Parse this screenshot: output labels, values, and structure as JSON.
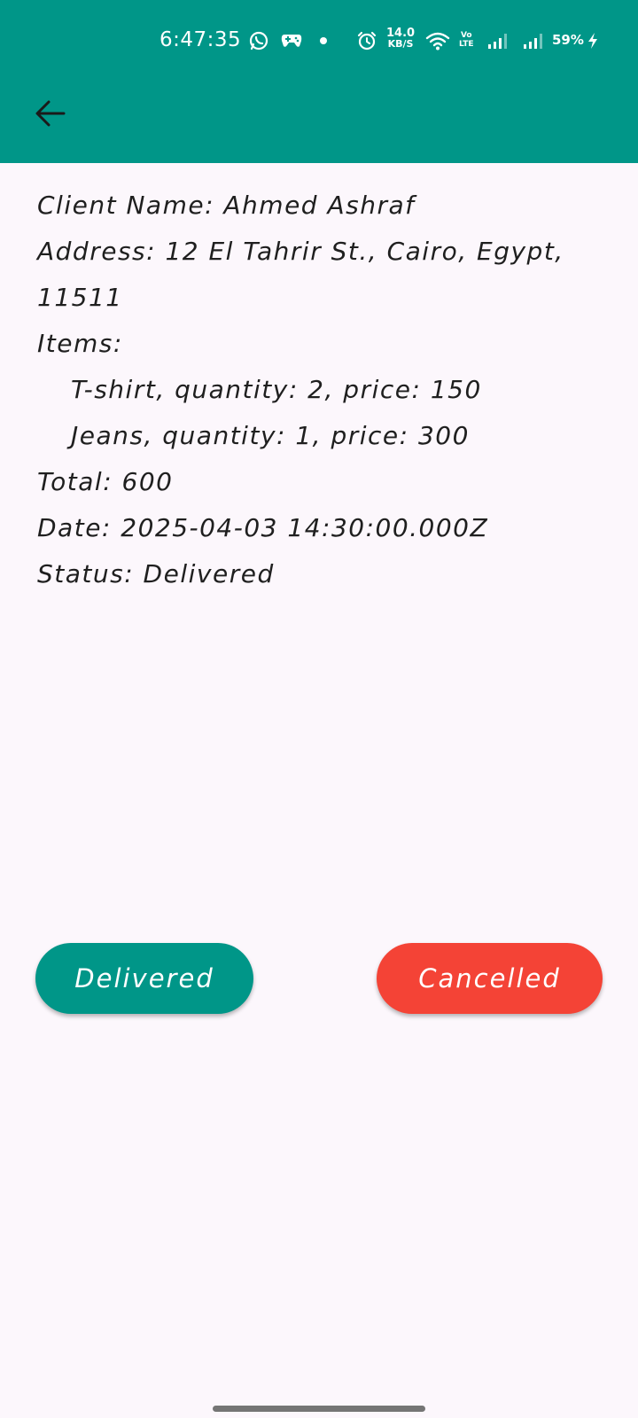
{
  "status_bar": {
    "time": "6:47:35",
    "net_speed_value": "14.0",
    "net_speed_unit": "KB/S",
    "volte_top": "Vo",
    "volte_bottom": "LTE",
    "battery": "59%",
    "icons": [
      "whatsapp-icon",
      "gamepad-icon",
      "dot-icon",
      "alarm-icon",
      "wifi-icon",
      "signal-icon",
      "signal-icon",
      "charging-icon"
    ]
  },
  "app_bar": {
    "back_icon": "arrow-left-icon",
    "color": "#009688"
  },
  "order": {
    "client_line": "Client Name: Ahmed Ashraf",
    "address_line_1": "Address: 12 El Tahrir St., Cairo, Egypt,",
    "address_line_2": "11511",
    "items_label": "Items:",
    "items": [
      "T-shirt, quantity: 2, price: 150",
      "Jeans, quantity: 1, price: 300"
    ],
    "total_line": "Total: 600",
    "date_line": "Date: 2025-04-03 14:30:00.000Z",
    "status_line": "Status: Delivered"
  },
  "actions": {
    "delivered_label": "Delivered",
    "cancelled_label": "Cancelled",
    "delivered_color": "#009688",
    "cancelled_color": "#f44336"
  }
}
